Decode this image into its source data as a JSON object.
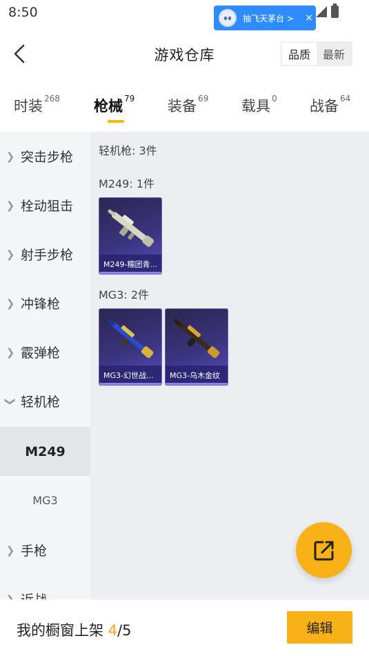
{
  "status": {
    "time": "8:50",
    "promo_text": "抽飞天茅台 >",
    "promo_close": "×"
  },
  "header": {
    "title": "游戏仓库",
    "sort": [
      "品质",
      "最新"
    ],
    "sort_active": "品质"
  },
  "tabs": [
    {
      "label": "时装",
      "count": "268"
    },
    {
      "label": "枪械",
      "count": "79",
      "active": true
    },
    {
      "label": "装备",
      "count": "69"
    },
    {
      "label": "载具",
      "count": "0"
    },
    {
      "label": "战备",
      "count": "64"
    }
  ],
  "sidebar": {
    "items": [
      {
        "label": "突击步枪"
      },
      {
        "label": "栓动狙击"
      },
      {
        "label": "射手步枪"
      },
      {
        "label": "冲锋枪"
      },
      {
        "label": "霰弹枪"
      },
      {
        "label": "轻机枪",
        "expanded": true
      },
      {
        "label": "手枪"
      },
      {
        "label": "近战"
      }
    ],
    "sub_items": [
      {
        "label": "M249",
        "active": true
      },
      {
        "label": "MG3"
      }
    ]
  },
  "main": {
    "category_title": "轻机枪: 3件",
    "groups": [
      {
        "title": "M249: 1件",
        "cards": [
          "M249-糯团青..."
        ]
      },
      {
        "title": "MG3: 2件",
        "cards": [
          "MG3-幻世战...",
          "MG3-乌木金纹"
        ]
      }
    ]
  },
  "bottom": {
    "showcase_prefix": "我的橱窗上架",
    "showcase_current": "4",
    "showcase_sep": "/",
    "showcase_total": "5",
    "edit_label": "编辑"
  },
  "colors": {
    "accent": "#f8b218",
    "card_bg": "#3b3480",
    "promo_bg": "#2f8cff"
  },
  "icons": [
    "back-arrow-icon",
    "share-icon",
    "chevron-right-icon",
    "chevron-down-icon",
    "signal-icon",
    "battery-icon"
  ]
}
